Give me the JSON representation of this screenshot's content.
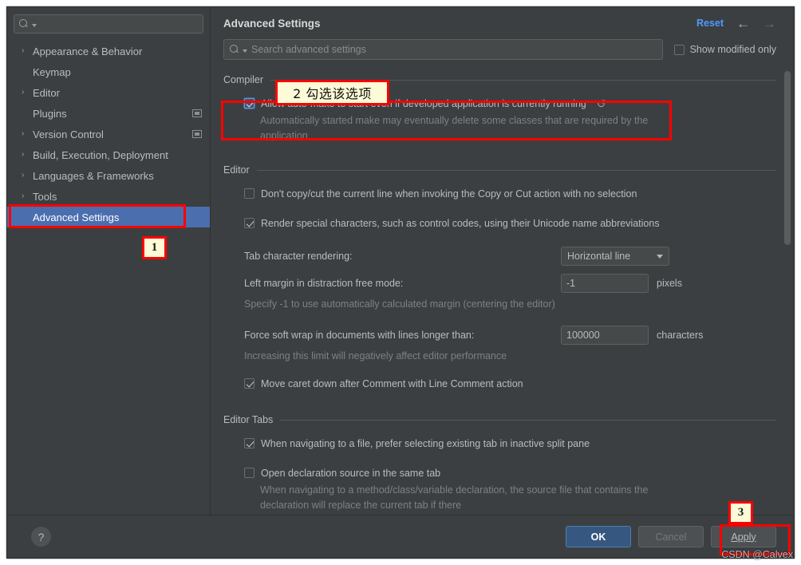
{
  "sidebar": {
    "search": {
      "placeholder": "",
      "value": "",
      "icon": "search-icon"
    },
    "items": [
      {
        "label": "Appearance & Behavior",
        "arrow": "›",
        "expandable": true,
        "badge": false,
        "selected": false
      },
      {
        "label": "Keymap",
        "arrow": "",
        "expandable": false,
        "badge": false,
        "selected": false
      },
      {
        "label": "Editor",
        "arrow": "›",
        "expandable": true,
        "badge": false,
        "selected": false
      },
      {
        "label": "Plugins",
        "arrow": "",
        "expandable": false,
        "badge": true,
        "selected": false
      },
      {
        "label": "Version Control",
        "arrow": "›",
        "expandable": true,
        "badge": true,
        "selected": false
      },
      {
        "label": "Build, Execution, Deployment",
        "arrow": "›",
        "expandable": true,
        "badge": false,
        "selected": false
      },
      {
        "label": "Languages & Frameworks",
        "arrow": "›",
        "expandable": true,
        "badge": false,
        "selected": false
      },
      {
        "label": "Tools",
        "arrow": "›",
        "expandable": true,
        "badge": false,
        "selected": false
      },
      {
        "label": "Advanced Settings",
        "arrow": "",
        "expandable": false,
        "badge": false,
        "selected": true
      }
    ]
  },
  "header": {
    "title": "Advanced Settings",
    "reset_label": "Reset",
    "back_arrow": "←",
    "forward_arrow": "→"
  },
  "search_row": {
    "placeholder": "Search advanced settings",
    "value": "",
    "show_modified_label": "Show modified only",
    "show_modified_checked": false
  },
  "groups": [
    {
      "title": "Compiler",
      "options": [
        {
          "type": "checkbox",
          "label": "Allow auto-make to start even if developed application is currently running",
          "checked": true,
          "focused": true,
          "rollback_icon": "↺",
          "desc": "Automatically started make may eventually delete some classes that are required by the application"
        }
      ]
    },
    {
      "title": "Editor",
      "options": [
        {
          "type": "checkbox",
          "label": "Don't copy/cut the current line when invoking the Copy or Cut action with no selection",
          "checked": false,
          "focused": false,
          "rollback_icon": "",
          "desc": ""
        },
        {
          "type": "checkbox",
          "label": "Render special characters, such as control codes, using their Unicode name abbreviations",
          "checked": true,
          "focused": false,
          "rollback_icon": "",
          "desc": ""
        },
        {
          "type": "combo",
          "label": "Tab character rendering:",
          "value": "Horizontal line",
          "unit": "",
          "desc": ""
        },
        {
          "type": "text",
          "label": "Left margin in distraction free mode:",
          "value": "-1",
          "unit": "pixels",
          "desc": "Specify -1 to use automatically calculated margin (centering the editor)"
        },
        {
          "type": "text",
          "label": "Force soft wrap in documents with lines longer than:",
          "value": "100000",
          "unit": "characters",
          "desc": "Increasing this limit will negatively affect editor performance"
        },
        {
          "type": "checkbox",
          "label": "Move caret down after Comment with Line Comment action",
          "checked": true,
          "focused": false,
          "rollback_icon": "",
          "desc": ""
        }
      ]
    },
    {
      "title": "Editor Tabs",
      "options": [
        {
          "type": "checkbox",
          "label": "When navigating to a file, prefer selecting existing tab in inactive split pane",
          "checked": true,
          "focused": false,
          "rollback_icon": "",
          "desc": ""
        },
        {
          "type": "checkbox",
          "label": "Open declaration source in the same tab",
          "checked": false,
          "focused": false,
          "rollback_icon": "",
          "desc": "When navigating to a method/class/variable declaration, the source file that contains the declaration will replace the current tab if there"
        }
      ]
    }
  ],
  "footer": {
    "help_glyph": "?",
    "ok_label": "OK",
    "cancel_label": "Cancel",
    "apply_label": "Apply"
  },
  "annotations": {
    "badge_1": "1",
    "note_2": "2 勾选该选项",
    "badge_3": "3",
    "watermark": "CSDN @Calvex",
    "accent_red": "#ff0000",
    "note_bg": "#fdfbd7"
  }
}
